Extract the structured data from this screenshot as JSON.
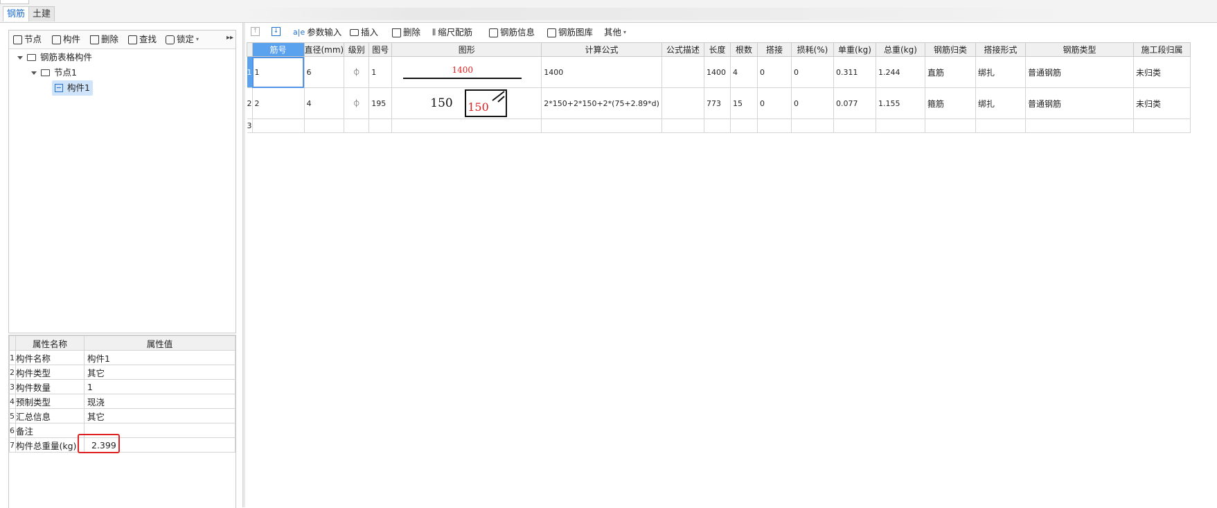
{
  "top_tabs": [
    {
      "label": "钢筋",
      "active": true
    },
    {
      "label": "土建",
      "active": false
    }
  ],
  "left_toolbar": [
    {
      "label": "节点",
      "icon": "add-node-icon"
    },
    {
      "label": "构件",
      "icon": "component-icon"
    },
    {
      "label": "删除",
      "icon": "trash-icon"
    },
    {
      "label": "查找",
      "icon": "find-icon"
    },
    {
      "label": "锁定",
      "icon": "lock-icon"
    }
  ],
  "tree": {
    "root": "钢筋表格构件",
    "node": "节点1",
    "component": "构件1"
  },
  "properties": {
    "headers": [
      "属性名称",
      "属性值"
    ],
    "rows": [
      {
        "no": "1",
        "name": "构件名称",
        "value": "构件1"
      },
      {
        "no": "2",
        "name": "构件类型",
        "value": "其它"
      },
      {
        "no": "3",
        "name": "构件数量",
        "value": "1"
      },
      {
        "no": "4",
        "name": "预制类型",
        "value": "现浇"
      },
      {
        "no": "5",
        "name": "汇总信息",
        "value": "其它"
      },
      {
        "no": "6",
        "name": "备注",
        "value": ""
      },
      {
        "no": "7",
        "name": "构件总重量(kg)",
        "value": "2.399"
      }
    ]
  },
  "right_toolbar": [
    {
      "label": "参数输入",
      "icon": "param-input-icon"
    },
    {
      "label": "插入",
      "icon": "insert-icon"
    },
    {
      "label": "删除",
      "icon": "trash-icon"
    },
    {
      "label": "缩尺配筋",
      "icon": "scale-rebar-icon"
    },
    {
      "label": "钢筋信息",
      "icon": "rebar-info-icon"
    },
    {
      "label": "钢筋图库",
      "icon": "rebar-library-icon"
    },
    {
      "label": "其他",
      "icon": "dropdown-icon"
    }
  ],
  "grid": {
    "headers": [
      "筋号",
      "直径(mm)",
      "级别",
      "图号",
      "图形",
      "计算公式",
      "公式描述",
      "长度",
      "根数",
      "搭接",
      "损耗(%)",
      "单重(kg)",
      "总重(kg)",
      "钢筋归类",
      "搭接形式",
      "钢筋类型",
      "施工段归属"
    ],
    "rows": [
      {
        "rowno": "1",
        "bar_no": "1",
        "diameter": "6",
        "grade": "⏀",
        "fig_no": "1",
        "shape_label": "1400",
        "formula": "1400",
        "desc": "",
        "length": "1400",
        "count": "4",
        "lap": "0",
        "loss": "0",
        "unit_weight": "0.311",
        "total_weight": "1.244",
        "category": "直筋",
        "lap_type": "绑扎",
        "rebar_type": "普通钢筋",
        "section": "未归类"
      },
      {
        "rowno": "2",
        "bar_no": "2",
        "diameter": "4",
        "grade": "⏀",
        "fig_no": "195",
        "shape_label_left": "150",
        "shape_label_box": "150",
        "formula": "2*150+2*150+2*(75+2.89*d)",
        "desc": "",
        "length": "773",
        "count": "15",
        "lap": "0",
        "loss": "0",
        "unit_weight": "0.077",
        "total_weight": "1.155",
        "category": "箍筋",
        "lap_type": "绑扎",
        "rebar_type": "普通钢筋",
        "section": "未归类"
      },
      {
        "rowno": "3"
      }
    ]
  },
  "colors": {
    "accent": "#1f6fd0",
    "header_highlight": "#5aa1ee",
    "annotation_red": "#e02020"
  }
}
